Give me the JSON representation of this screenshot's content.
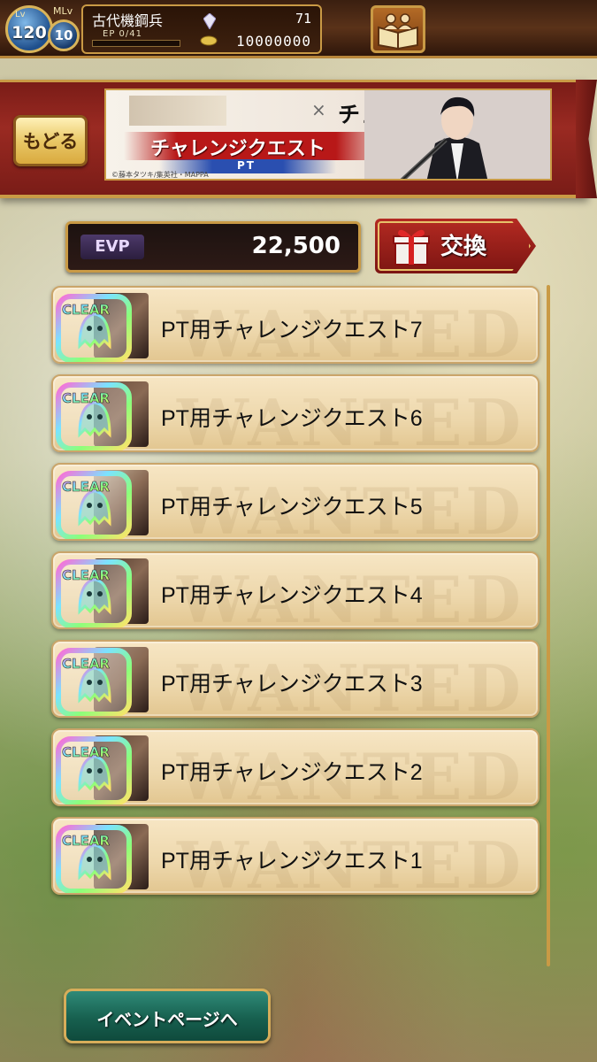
{
  "status_bar": {
    "lv_label": "Lv",
    "level": "120",
    "mlv_label": "MLv",
    "mlv": "10",
    "player_name": "古代機鋼兵",
    "ep_text": "EP  0/41",
    "ep_progress": 0,
    "crystals": "71",
    "gold": "10000000",
    "icons": [
      "crystal-icon",
      "coin-icon",
      "book-people-icon"
    ]
  },
  "header": {
    "back_label": "もどる",
    "banner": {
      "collab_mark": "×",
      "title": "チェンソーマン",
      "subtitle": "チャレンジクエスト",
      "tag": "PT",
      "copyright": "©藤本タツキ/集英社・MAPPA"
    }
  },
  "evp": {
    "label": "EVP",
    "value": "22,500",
    "exchange_label": "交換"
  },
  "quests": [
    {
      "title": "PT用チャレンジクエスト7",
      "status": "CLEAR"
    },
    {
      "title": "PT用チャレンジクエスト6",
      "status": "CLEAR"
    },
    {
      "title": "PT用チャレンジクエスト5",
      "status": "CLEAR"
    },
    {
      "title": "PT用チャレンジクエスト4",
      "status": "CLEAR"
    },
    {
      "title": "PT用チャレンジクエスト3",
      "status": "CLEAR"
    },
    {
      "title": "PT用チャレンジクエスト2",
      "status": "CLEAR"
    },
    {
      "title": "PT用チャレンジクエスト1",
      "status": "CLEAR"
    }
  ],
  "watermark": "WANTED",
  "footer": {
    "event_page_label": "イベントページへ"
  }
}
